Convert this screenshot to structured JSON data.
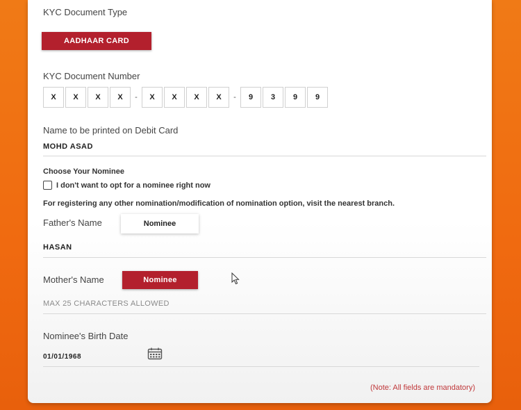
{
  "kyc": {
    "doc_type_label": "KYC Document Type",
    "doc_type_value": "AADHAAR CARD",
    "doc_number_label": "KYC Document Number",
    "digits": [
      "X",
      "X",
      "X",
      "X",
      "-",
      "X",
      "X",
      "X",
      "X",
      "-",
      "9",
      "3",
      "9",
      "9"
    ]
  },
  "debit_card": {
    "name_label": "Name to be printed on Debit Card",
    "name_value": "MOHD ASAD"
  },
  "nominee": {
    "heading": "Choose Your Nominee",
    "opt_out_label": "I don't want to opt for a nominee right now",
    "opt_out_checked": false,
    "info_text": "For registering any other nomination/modification of nomination option, visit the nearest branch.",
    "father_label": "Father's Name",
    "father_button": "Nominee",
    "father_value": "HASAN",
    "mother_label": "Mother's Name",
    "mother_button": "Nominee",
    "mother_placeholder": "MAX 25 CHARACTERS ALLOWED",
    "birth_label": "Nominee's Birth Date",
    "birth_value": "01/01/1968"
  },
  "footer": {
    "note": "(Note: All fields are mandatory)"
  },
  "colors": {
    "accent_red": "#b3202d",
    "background_orange": "#f07a16",
    "note_red": "#c0393b"
  }
}
